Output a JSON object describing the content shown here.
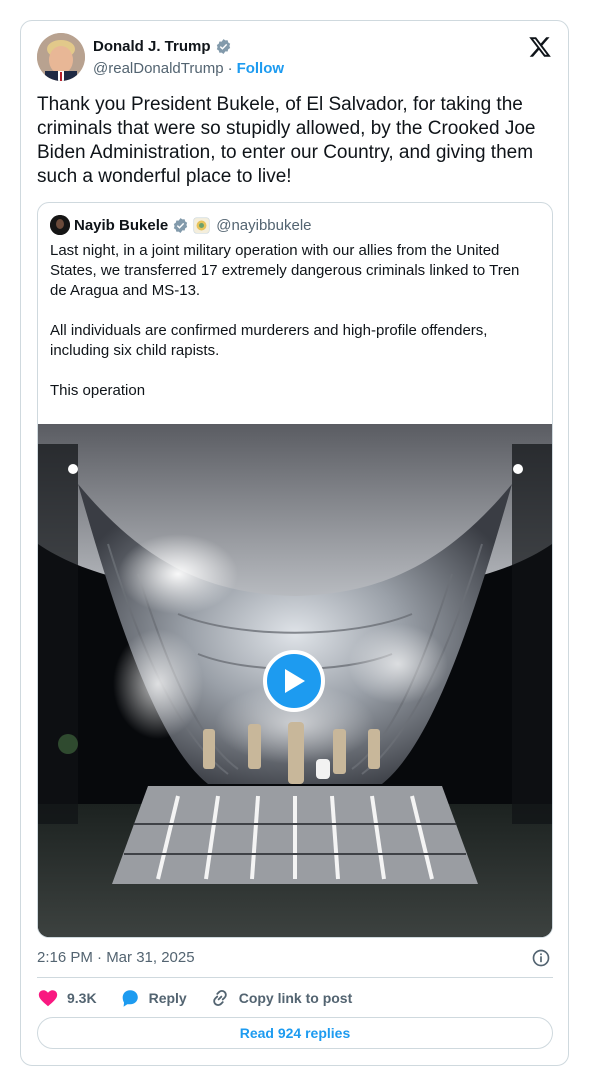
{
  "author": {
    "name": "Donald J. Trump",
    "handle": "@realDonaldTrump",
    "separator": "·",
    "follow_label": "Follow"
  },
  "tweet": {
    "text": "Thank you President Bukele, of El Salvador, for taking the criminals that were so stupidly allowed, by the Crooked Joe Biden Administration, to enter our Country, and giving them such a wonderful place to live!"
  },
  "quoted": {
    "name": "Nayib Bukele",
    "handle": "@nayibbukele",
    "paragraphs": [
      "Last night, in a joint military operation with our allies from the United States, we transferred 17 extremely dangerous criminals linked to Tren de Aragua and MS-13.",
      "All individuals are confirmed murderers and high-profile offenders, including six child rapists.",
      "This operation"
    ]
  },
  "meta": {
    "timestamp": "2:16 PM · Mar 31, 2025"
  },
  "actions": {
    "likes": "9.3K",
    "reply_label": "Reply",
    "copy_label": "Copy link to post"
  },
  "read_replies_label": "Read 924 replies",
  "colors": {
    "accent": "#1d9bf0",
    "like": "#f91880",
    "muted": "#536471",
    "border": "#cfd9de"
  },
  "icons": [
    "verified-badge-icon",
    "x-logo-icon",
    "play-icon",
    "info-icon",
    "heart-icon",
    "reply-bubble-icon",
    "link-icon"
  ]
}
